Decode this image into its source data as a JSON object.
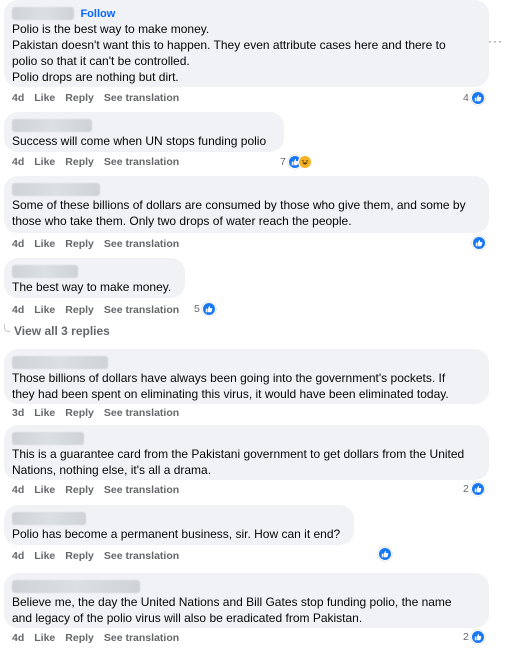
{
  "comments": [
    {
      "follow_label": "Follow",
      "text_lines": [
        "Polio is the best way to make money.",
        "Pakistan doesn't want this to happen. They even attribute cases here and there to",
        "polio so that it can't be controlled.",
        "Polio drops are nothing but dirt."
      ],
      "time": "4d",
      "like": "Like",
      "reply": "Reply",
      "translate": "See translation",
      "reaction_count": "4",
      "reactions": [
        "like-icon"
      ]
    },
    {
      "text_lines": [
        "Success will come when UN stops funding polio"
      ],
      "time": "4d",
      "like": "Like",
      "reply": "Reply",
      "translate": "See translation",
      "reaction_count": "7",
      "reactions": [
        "like-icon",
        "haha-icon"
      ]
    },
    {
      "text_lines": [
        "Some of these billions of dollars are consumed by those who give them, and some by",
        "those who take them. Only two drops of water reach the people."
      ],
      "time": "4d",
      "like": "Like",
      "reply": "Reply",
      "translate": "See translation",
      "reaction_count": "",
      "reactions": [
        "like-icon"
      ]
    },
    {
      "text_lines": [
        "The best way to make money."
      ],
      "time": "4d",
      "like": "Like",
      "reply": "Reply",
      "translate": "See translation",
      "reaction_count": "5",
      "reactions": [
        "like-icon"
      ]
    },
    {
      "text_lines": [
        "Those billions of dollars have always been going into the government's pockets. If",
        "they had been spent on eliminating this virus, it would have been eliminated today."
      ],
      "time": "3d",
      "like": "Like",
      "reply": "Reply",
      "translate": "See translation",
      "reaction_count": "",
      "reactions": []
    },
    {
      "text_lines": [
        "This is a guarantee card from the Pakistani government to get dollars from the United",
        "Nations, nothing else, it's all a drama."
      ],
      "time": "4d",
      "like": "Like",
      "reply": "Reply",
      "translate": "See translation",
      "reaction_count": "2",
      "reactions": [
        "like-icon"
      ]
    },
    {
      "text_lines": [
        "Polio has become a permanent business, sir. How can it end?"
      ],
      "time": "4d",
      "like": "Like",
      "reply": "Reply",
      "translate": "See translation",
      "reaction_count": "",
      "reactions": [
        "like-icon"
      ]
    },
    {
      "text_lines": [
        "Believe me, the day the United Nations and Bill Gates stop funding polio, the name",
        "and legacy of the polio virus will also be eradicated from Pakistan."
      ],
      "time": "4d",
      "like": "Like",
      "reply": "Reply",
      "translate": "See translation",
      "reaction_count": "2",
      "reactions": [
        "like-icon"
      ]
    }
  ],
  "view_replies": "View all 3 replies",
  "more_options": "···",
  "colors": {
    "bubble": "#f0f2f5",
    "accent": "#0866ff",
    "like": "#1877f2",
    "secondary": "#65676b"
  }
}
